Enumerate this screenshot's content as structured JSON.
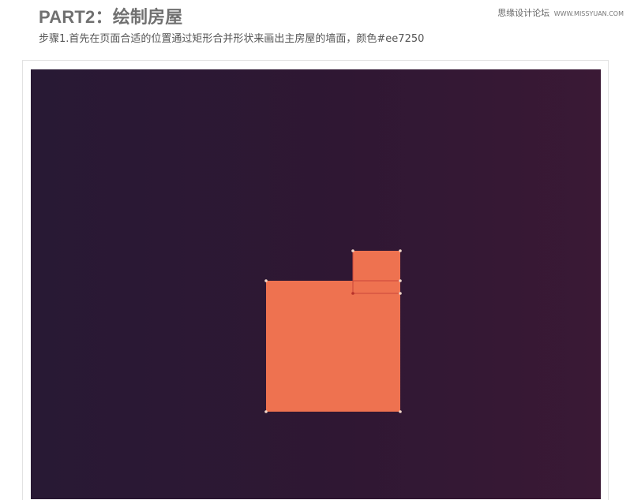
{
  "header": {
    "title": "PART2：绘制房屋",
    "watermark_text": "思缘设计论坛",
    "watermark_site": "WWW.MISSYUAN.COM"
  },
  "step": {
    "description": "步骤1.首先在页面合适的位置通过矩形合并形状来画出主房屋的墙面，颜色#ee7250"
  },
  "canvas": {
    "background_colors": [
      "#281934",
      "#3a1935"
    ],
    "shape_color": "#ee7250",
    "anchor_color": "#f0d6c8"
  }
}
